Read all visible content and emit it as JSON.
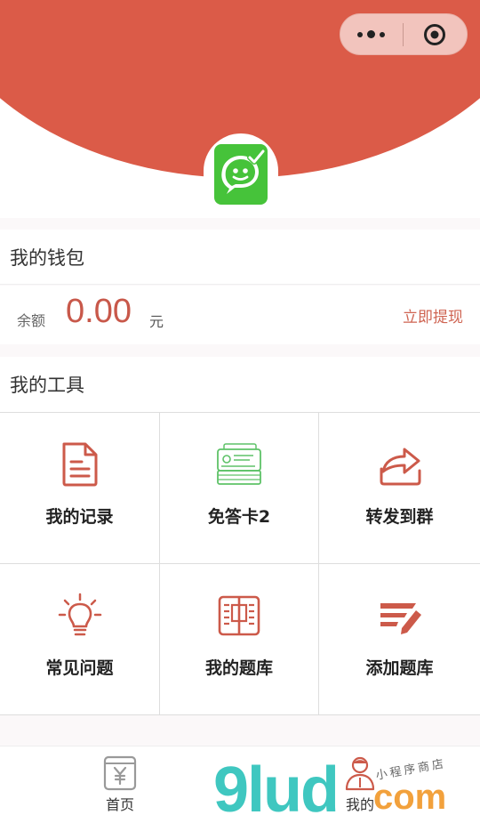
{
  "colors": {
    "brand_red": "#db5b48",
    "accent_text": "#cf6452",
    "logo_green": "#46c33a",
    "icon_red": "#cc5a4a",
    "icon_green": "#5ec268"
  },
  "header": {
    "capsule_menu_icon": "more-dots-icon",
    "capsule_close_icon": "target-circle-icon",
    "logo_icon": "chat-check-logo-icon"
  },
  "wallet": {
    "title": "我的钱包",
    "balance_label": "余额",
    "balance_amount": "0.00",
    "balance_unit": "元",
    "withdraw_label": "立即提现"
  },
  "tools": {
    "title": "我的工具",
    "items": [
      {
        "label": "我的记录",
        "icon": "document-icon"
      },
      {
        "label": "免答卡2",
        "icon": "card-icon"
      },
      {
        "label": "转发到群",
        "icon": "share-icon"
      },
      {
        "label": "常见问题",
        "icon": "lightbulb-icon"
      },
      {
        "label": "我的题库",
        "icon": "book-icon"
      },
      {
        "label": "添加题库",
        "icon": "add-bank-icon"
      }
    ]
  },
  "tabbar": {
    "items": [
      {
        "label": "首页",
        "icon": "yen-wallet-icon"
      },
      {
        "label": "我的",
        "icon": "profile-icon"
      }
    ]
  },
  "watermark": {
    "main": "9lud",
    "com": "com",
    "small": "小程序商店"
  }
}
